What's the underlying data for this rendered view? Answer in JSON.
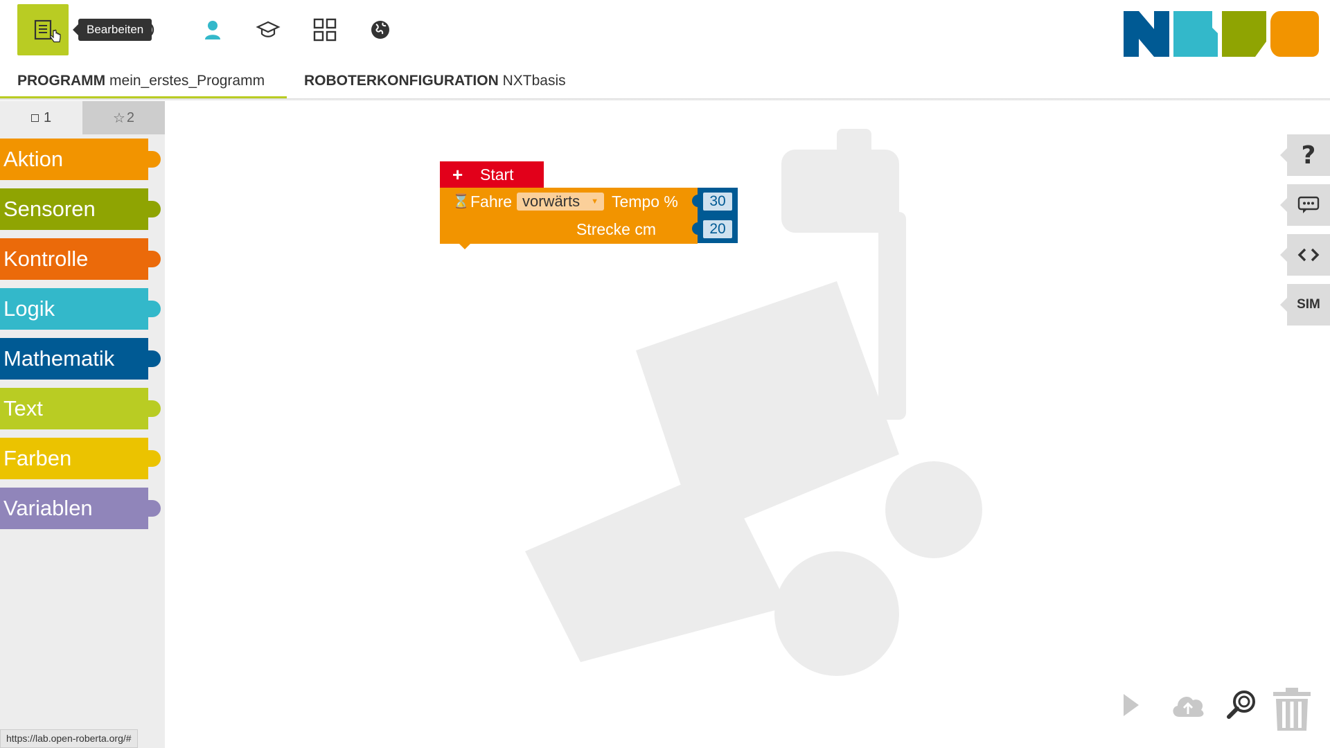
{
  "toolbar": {
    "tooltip": "Bearbeiten",
    "buttons": [
      "edit-icon",
      "help-icon",
      "user-icon",
      "gallery-icon",
      "apps-icon",
      "language-icon"
    ]
  },
  "tabs": [
    {
      "key": "PROGRAMM",
      "value": "mein_erstes_Programm"
    },
    {
      "key": "ROBOTERKONFIGURATION",
      "value": "NXTbasis"
    }
  ],
  "toolbox": {
    "levels": [
      {
        "icon": "square-icon",
        "label": "1"
      },
      {
        "icon": "star-icon",
        "label": "2"
      }
    ],
    "categories": [
      {
        "label": "Aktion",
        "color": "#f29400"
      },
      {
        "label": "Sensoren",
        "color": "#8fa402"
      },
      {
        "label": "Kontrolle",
        "color": "#eb6a0a"
      },
      {
        "label": "Logik",
        "color": "#33b8ca"
      },
      {
        "label": "Mathematik",
        "color": "#005a94"
      },
      {
        "label": "Text",
        "color": "#b9cc23"
      },
      {
        "label": "Farben",
        "color": "#ebc300"
      },
      {
        "label": "Variablen",
        "color": "#9085ba"
      }
    ]
  },
  "blocks": {
    "start_label": "Start",
    "drive_label": "Fahre",
    "direction": "vorwärts",
    "speed_label": "Tempo %",
    "speed_value": "30",
    "distance_label": "Strecke cm",
    "distance_value": "20"
  },
  "side_tabs": [
    "help-icon",
    "comment-icon",
    "code-icon",
    "SIM"
  ],
  "status_url": "https://lab.open-roberta.org/#",
  "colors": {
    "accent": "#b9cc23",
    "start_red": "#e2001a",
    "action_orange": "#f29400",
    "math_blue": "#005a94"
  }
}
